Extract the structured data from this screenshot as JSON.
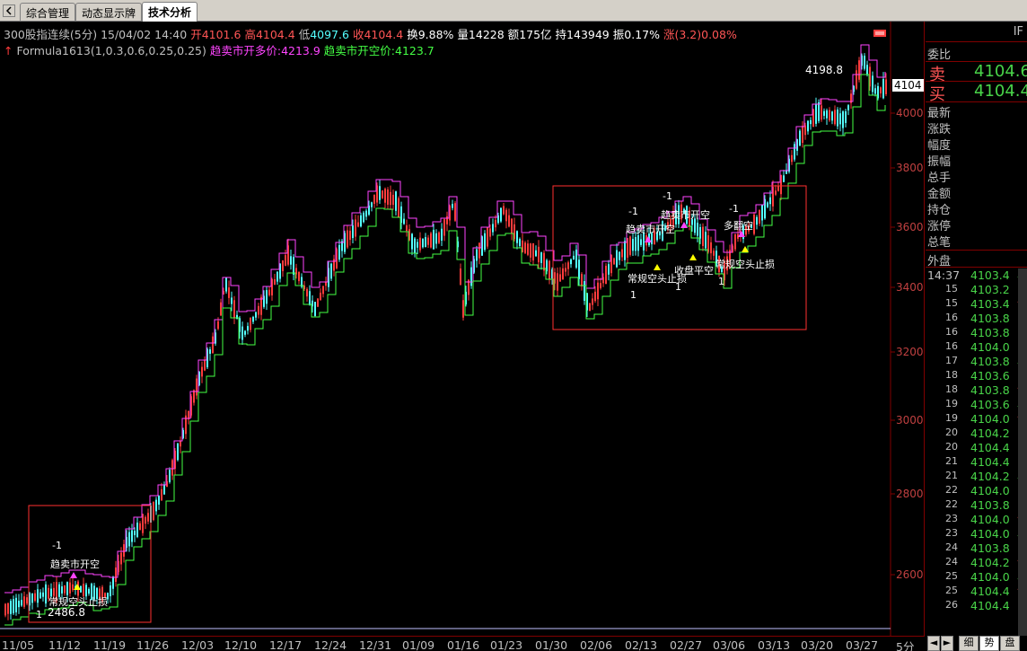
{
  "tabs": [
    {
      "label": "综合管理",
      "active": false
    },
    {
      "label": "动态显示牌",
      "active": false
    },
    {
      "label": "技术分析",
      "active": true
    }
  ],
  "quote": {
    "name": "300股指连续",
    "period_label": "(5分)",
    "datetime": "15/04/02 14:40",
    "open_label": "开",
    "open": "4101.6",
    "high_label": "高",
    "high": "4104.4",
    "low_label": "低",
    "low": "4097.6",
    "close_label": "收",
    "close": "4104.4",
    "turnover_label": "换",
    "turnover": "9.88%",
    "volume_label": "量",
    "volume": "14228",
    "amount_label": "额",
    "amount": "175亿",
    "oi_label": "持",
    "oi": "143949",
    "amp_label": "振",
    "amp": "0.17%",
    "chg_label": "涨",
    "chg": "(3.2)0.08%"
  },
  "formula": {
    "name": "Formula1613(1,0.3,0.6,0.25,0.25)",
    "long_label": "趋卖市开多价:",
    "long_value": "4213.9",
    "short_label": "趋卖市开空价:",
    "short_value": "4123.7"
  },
  "chart": {
    "price_ticks": [
      "4000",
      "3800",
      "3600",
      "3400",
      "3200",
      "3000",
      "2800",
      "2600"
    ],
    "current_price_tag": "4104",
    "high_annotation": "4198.8",
    "low_annotation": "2486.8",
    "signals": {
      "sell_open_short": "趋卖市开空",
      "stop_short": "常规空头止损",
      "close_flat": "收盘平空",
      "buy_open_long": "多翻空",
      "minus_one": "-1",
      "one": "1"
    },
    "x_labels": [
      "11/05",
      "11/12",
      "11/19",
      "11/26",
      "12/03",
      "12/10",
      "12/17",
      "12/24",
      "12/31",
      "01/09",
      "01/16",
      "01/23",
      "01/30",
      "02/06",
      "02/13",
      "02/27",
      "03/06",
      "03/13",
      "03/20",
      "03/27"
    ],
    "period": "5分",
    "colors": {
      "up": "#ff3c3c",
      "down": "#54ffff",
      "long_line": "#ff44ff",
      "short_line": "#44ff44",
      "box": "#ff3030",
      "yellow": "#ffff00"
    }
  },
  "right_panel": {
    "code": "IF",
    "weibi": "委比",
    "sell_label": "卖",
    "sell_price": "4104.6",
    "buy_label": "买",
    "buy_price": "4104.4",
    "fields": [
      "最新",
      "涨跌",
      "幅度",
      "振幅",
      "总手",
      "金额",
      "持仓",
      "涨停",
      "总笔"
    ],
    "outer_label": "外盘",
    "trades": [
      {
        "time": "14:37",
        "price": "4103.4",
        "arrow": "↓"
      },
      {
        "time": "15",
        "price": "4103.2",
        "arrow": ""
      },
      {
        "time": "15",
        "price": "4103.4",
        "arrow": "↑"
      },
      {
        "time": "16",
        "price": "4103.8",
        "arrow": ""
      },
      {
        "time": "16",
        "price": "4103.8",
        "arrow": ""
      },
      {
        "time": "16",
        "price": "4104.0",
        "arrow": ""
      },
      {
        "time": "17",
        "price": "4103.8",
        "arrow": "↓"
      },
      {
        "time": "18",
        "price": "4103.6",
        "arrow": ""
      },
      {
        "time": "18",
        "price": "4103.8",
        "arrow": "↑"
      },
      {
        "time": "19",
        "price": "4103.6",
        "arrow": "↓"
      },
      {
        "time": "19",
        "price": "4104.0",
        "arrow": "↑"
      },
      {
        "time": "20",
        "price": "4104.2",
        "arrow": ""
      },
      {
        "time": "20",
        "price": "4104.4",
        "arrow": ""
      },
      {
        "time": "21",
        "price": "4104.4",
        "arrow": ""
      },
      {
        "time": "21",
        "price": "4104.2",
        "arrow": "↓"
      },
      {
        "time": "22",
        "price": "4104.0",
        "arrow": ""
      },
      {
        "time": "22",
        "price": "4103.8",
        "arrow": ""
      },
      {
        "time": "23",
        "price": "4104.0",
        "arrow": "↑"
      },
      {
        "time": "23",
        "price": "4104.0",
        "arrow": "↓"
      },
      {
        "time": "24",
        "price": "4103.8",
        "arrow": ""
      },
      {
        "time": "24",
        "price": "4104.2",
        "arrow": "↑"
      },
      {
        "time": "25",
        "price": "4104.0",
        "arrow": "↓"
      },
      {
        "time": "25",
        "price": "4104.4",
        "arrow": "↑"
      },
      {
        "time": "26",
        "price": "4104.4",
        "arrow": ""
      }
    ],
    "bottom_tabs": [
      "细",
      "势",
      "盘"
    ]
  }
}
